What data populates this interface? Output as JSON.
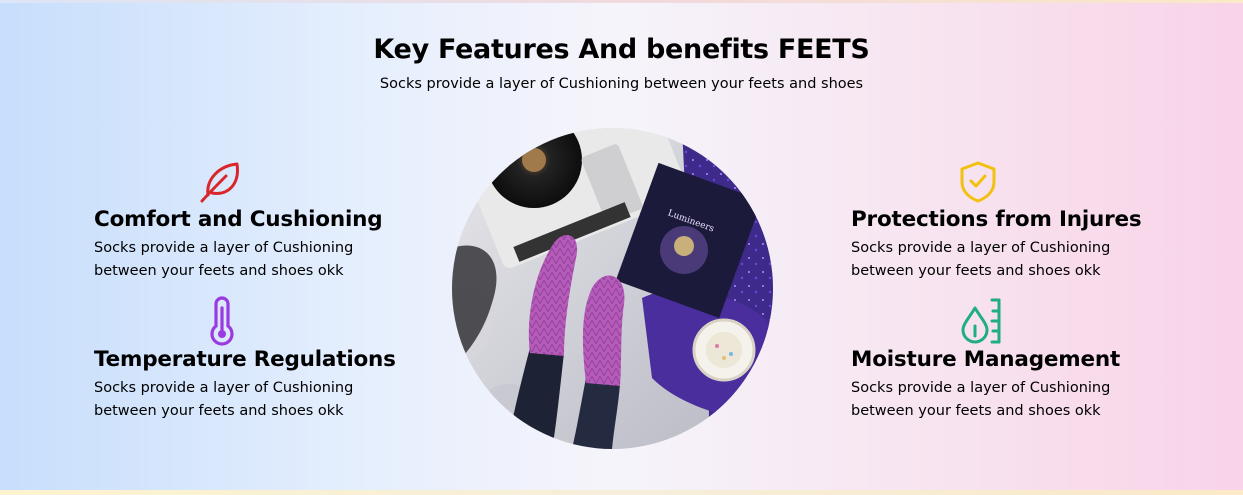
{
  "header": {
    "title": "Key Features And benefits FEETS",
    "subtitle": "Socks provide a layer of Cushioning between your feets and shoes"
  },
  "features": [
    {
      "icon": "leaf-icon",
      "title": "Comfort and Cushioning",
      "description": "Socks provide a layer of Cushioning between your feets and shoes okk",
      "color": "#d9262b"
    },
    {
      "icon": "thermometer-icon",
      "title": "Temperature Regulations",
      "description": "Socks provide a layer of Cushioning between your feets and shoes okk",
      "color": "#9a3ae0"
    },
    {
      "icon": "shield-check-icon",
      "title": "Protections from Injures",
      "description": "Socks provide a layer of Cushioning between your feets and shoes okk",
      "color": "#f2c10f"
    },
    {
      "icon": "droplet-ruler-icon",
      "title": "Moisture Management",
      "description": "Socks provide a layer of Cushioning between your feets and shoes okk",
      "color": "#1fae84"
    }
  ],
  "image": {
    "alt": "Purple knitted socks on a bed next to a record player, vinyl record and candle"
  },
  "record": {
    "title": "Lumineers"
  }
}
